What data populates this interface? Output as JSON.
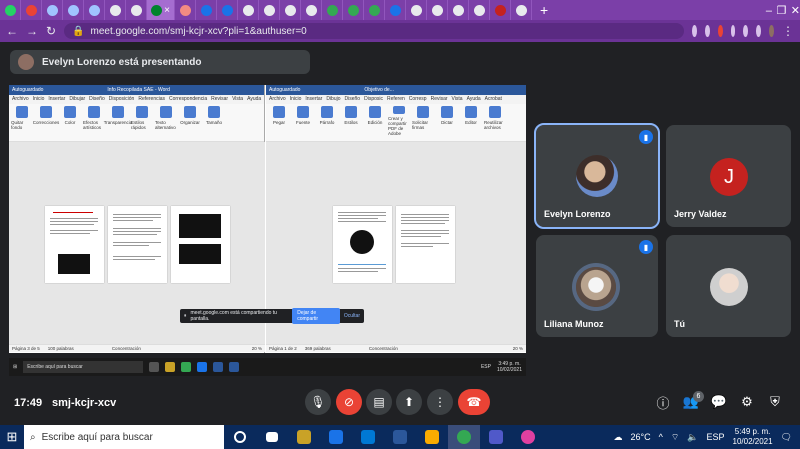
{
  "browser": {
    "active_tab_close": "×",
    "new_tab": "+",
    "url": "meet.google.com/smj-kcjr-xcv?pli=1&authuser=0",
    "window_controls": [
      "–",
      "❐",
      "✕"
    ]
  },
  "presenting": {
    "text": "Evelyn Lorenzo está presentando"
  },
  "shared_screen": {
    "left_window_title": "Info Recopilada SAE - Word",
    "right_window_title": "Objetivo de...",
    "autosave": "Autoguardado",
    "left_menu": [
      "Archivo",
      "Inicio",
      "Insertar",
      "Dibujar",
      "Diseño",
      "Disposición",
      "Referencias",
      "Correspondencia",
      "Revisar",
      "Vista",
      "Ayuda"
    ],
    "right_menu": [
      "Archivo",
      "Inicio",
      "Insertar",
      "Dibujo",
      "Diseño",
      "Disposic",
      "Referen",
      "Corresp",
      "Revisar",
      "Vista",
      "Ayuda",
      "Acrobat"
    ],
    "left_ribbon": [
      "Quitar fondo",
      "Correcciones",
      "Color",
      "Efectos artísticos",
      "Transparencia",
      "Estilos rápidos",
      "Texto alternativo",
      "Organizar",
      "Tamaño"
    ],
    "left_groups": [
      "Ajustar",
      "Estilos de imagen",
      "Accesibilidad"
    ],
    "right_ribbon": [
      "Pegar",
      "Fuente",
      "Párrafo",
      "Estilos",
      "Edición",
      "Crear y compartir PDF de Adobe",
      "Solicitar firmas",
      "Dictar",
      "Editor",
      "Reutilizar archivos"
    ],
    "right_groups": [
      "Portapapeles",
      "Estilos",
      "Adobe Acrobat",
      "Voz",
      "Editor",
      "Reutilizar arc..."
    ],
    "left_status": [
      "Página 3 de 5",
      "100 palabras",
      "Concentración"
    ],
    "right_status": [
      "Página 1 de 2",
      "369 palabras",
      "Concentración"
    ],
    "left_zoom": "20 %",
    "right_zoom": "20 %",
    "share_notice": "meet.google.com está compartiendo tu pantalla.",
    "stop_sharing": "Dejar de compartir",
    "hide": "Ocultar",
    "inner_search": "Escribe aquí para buscar",
    "inner_time": "3:49 p. m.",
    "inner_date": "10/02/2021",
    "inner_lang": "ESP"
  },
  "participants": [
    {
      "name": "Evelyn Lorenzo",
      "speaking": true,
      "active": true
    },
    {
      "name": "Jerry Valdez",
      "initial": "J"
    },
    {
      "name": "Liliana Munoz",
      "speaking": true
    },
    {
      "name": "Tú"
    }
  ],
  "meet_bar": {
    "time": "17:49",
    "meeting_code": "smj-kcjr-xcv",
    "participants_count": "6"
  },
  "taskbar": {
    "search_placeholder": "Escribe aquí para buscar",
    "temperature": "26°C",
    "language": "ESP",
    "time": "5:49 p. m.",
    "date": "10/02/2021"
  },
  "colors": {
    "browser_frame": "#7b3fa8",
    "meet_background": "#202124",
    "tile": "#3c4043",
    "end_call": "#ea4335",
    "accent": "#8ab4f8"
  }
}
